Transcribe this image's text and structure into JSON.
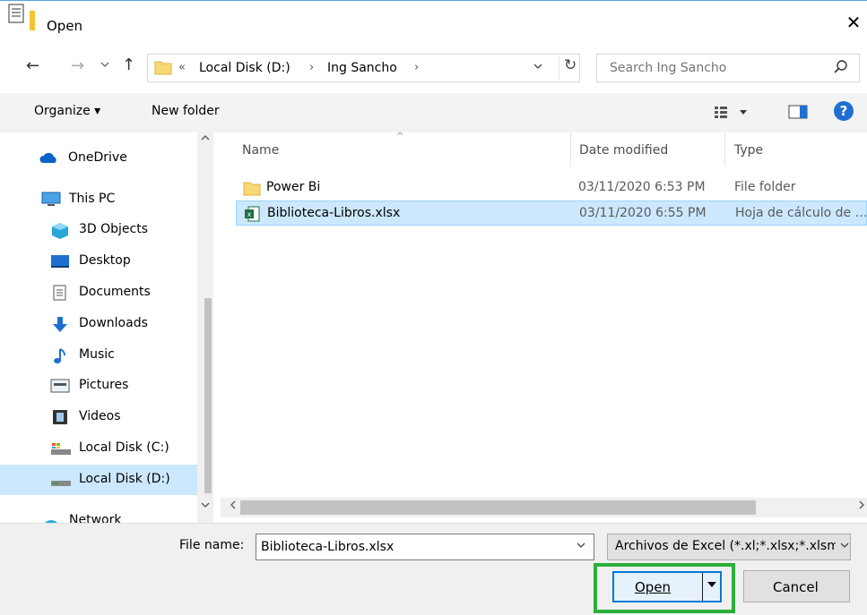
{
  "window": {
    "title": "Open",
    "close_glyph": "✕"
  },
  "nav": {
    "back_glyph": "←",
    "forward_glyph": "→",
    "recent_glyph": "⌄",
    "up_glyph": "↑",
    "address": {
      "overflow": "«",
      "crumbs": [
        "Local Disk (D:)",
        "Ing Sancho"
      ],
      "separator": "›",
      "dropdown_glyph": "⌄",
      "refresh_glyph": "↻"
    },
    "search": {
      "placeholder": "Search Ing Sancho"
    }
  },
  "toolbar": {
    "organize_label": "Organize ▾",
    "new_folder_label": "New folder",
    "help_label": "?"
  },
  "sidebar": {
    "items": [
      {
        "label": "OneDrive",
        "icon": "cloud-icon"
      },
      {
        "label": "This PC",
        "icon": "computer-icon"
      },
      {
        "label": "3D Objects",
        "icon": "cube-icon"
      },
      {
        "label": "Desktop",
        "icon": "desktop-icon"
      },
      {
        "label": "Documents",
        "icon": "document-icon"
      },
      {
        "label": "Downloads",
        "icon": "download-icon"
      },
      {
        "label": "Music",
        "icon": "music-icon"
      },
      {
        "label": "Pictures",
        "icon": "pictures-icon"
      },
      {
        "label": "Videos",
        "icon": "video-icon"
      },
      {
        "label": "Local Disk (C:)",
        "icon": "drive-icon"
      },
      {
        "label": "Local Disk (D:)",
        "icon": "drive-icon",
        "selected": true
      },
      {
        "label": "Network",
        "icon": "network-icon"
      }
    ]
  },
  "file_list": {
    "columns": [
      "Name",
      "Date modified",
      "Type"
    ],
    "sort_glyph": "^",
    "rows": [
      {
        "name": "Power Bi",
        "date": "03/11/2020 6:53 PM",
        "type": "File folder",
        "icon": "folder-icon"
      },
      {
        "name": "Biblioteca-Libros.xlsx",
        "date": "03/11/2020 6:55 PM",
        "type": "Hoja de cálculo de Microsoft Excel",
        "icon": "excel-file-icon",
        "selected": true
      }
    ]
  },
  "bottom": {
    "file_name_label": "File name:",
    "file_name_value": "Biblioteca-Libros.xlsx",
    "filter_value": "Archivos de Excel (*.xl;*.xlsx;*.xlsm;*.xlsb)",
    "open_label": "Open",
    "cancel_label": "Cancel"
  },
  "colors": {
    "accent": "#0078d7",
    "selection": "#cce8ff",
    "highlight": "#2bb03a"
  }
}
